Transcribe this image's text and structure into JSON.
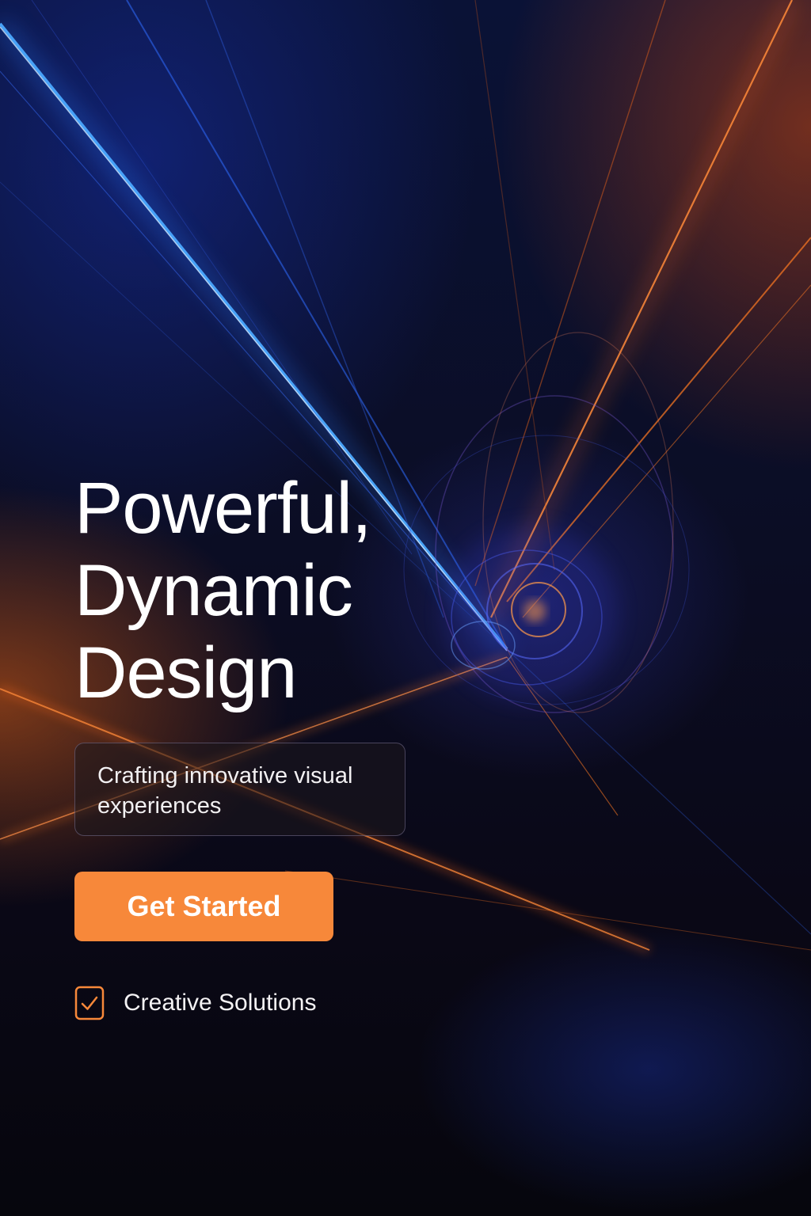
{
  "hero": {
    "headline": [
      "Powerful,",
      "Dynamic",
      "Design"
    ],
    "subtitle": "Crafting innovative visual experiences",
    "cta_label": "Get Started"
  },
  "feature": {
    "label": "Creative Solutions",
    "icon": "checkbox-checked-icon"
  },
  "colors": {
    "accent": "#f7883a",
    "blue_beam": "#2f8cff",
    "orange_beam": "#ff7a22",
    "background": "#0a0c22"
  }
}
